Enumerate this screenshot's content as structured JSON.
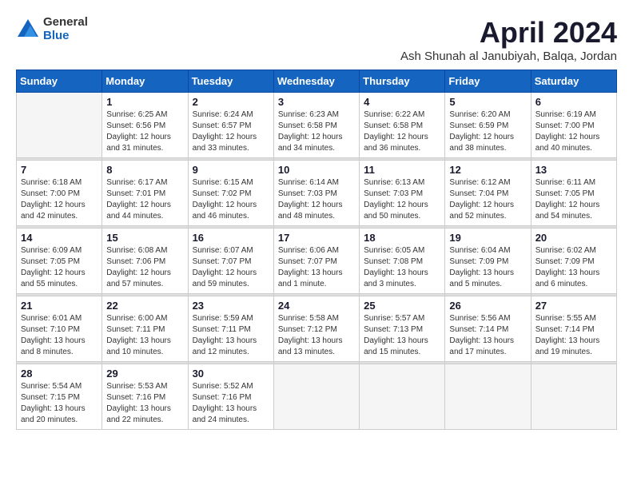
{
  "logo": {
    "general": "General",
    "blue": "Blue"
  },
  "header": {
    "month_year": "April 2024",
    "location": "Ash Shunah al Janubiyah, Balqa, Jordan"
  },
  "weekdays": [
    "Sunday",
    "Monday",
    "Tuesday",
    "Wednesday",
    "Thursday",
    "Friday",
    "Saturday"
  ],
  "weeks": [
    [
      {
        "day": "",
        "info": ""
      },
      {
        "day": "1",
        "info": "Sunrise: 6:25 AM\nSunset: 6:56 PM\nDaylight: 12 hours\nand 31 minutes."
      },
      {
        "day": "2",
        "info": "Sunrise: 6:24 AM\nSunset: 6:57 PM\nDaylight: 12 hours\nand 33 minutes."
      },
      {
        "day": "3",
        "info": "Sunrise: 6:23 AM\nSunset: 6:58 PM\nDaylight: 12 hours\nand 34 minutes."
      },
      {
        "day": "4",
        "info": "Sunrise: 6:22 AM\nSunset: 6:58 PM\nDaylight: 12 hours\nand 36 minutes."
      },
      {
        "day": "5",
        "info": "Sunrise: 6:20 AM\nSunset: 6:59 PM\nDaylight: 12 hours\nand 38 minutes."
      },
      {
        "day": "6",
        "info": "Sunrise: 6:19 AM\nSunset: 7:00 PM\nDaylight: 12 hours\nand 40 minutes."
      }
    ],
    [
      {
        "day": "7",
        "info": "Sunrise: 6:18 AM\nSunset: 7:00 PM\nDaylight: 12 hours\nand 42 minutes."
      },
      {
        "day": "8",
        "info": "Sunrise: 6:17 AM\nSunset: 7:01 PM\nDaylight: 12 hours\nand 44 minutes."
      },
      {
        "day": "9",
        "info": "Sunrise: 6:15 AM\nSunset: 7:02 PM\nDaylight: 12 hours\nand 46 minutes."
      },
      {
        "day": "10",
        "info": "Sunrise: 6:14 AM\nSunset: 7:03 PM\nDaylight: 12 hours\nand 48 minutes."
      },
      {
        "day": "11",
        "info": "Sunrise: 6:13 AM\nSunset: 7:03 PM\nDaylight: 12 hours\nand 50 minutes."
      },
      {
        "day": "12",
        "info": "Sunrise: 6:12 AM\nSunset: 7:04 PM\nDaylight: 12 hours\nand 52 minutes."
      },
      {
        "day": "13",
        "info": "Sunrise: 6:11 AM\nSunset: 7:05 PM\nDaylight: 12 hours\nand 54 minutes."
      }
    ],
    [
      {
        "day": "14",
        "info": "Sunrise: 6:09 AM\nSunset: 7:05 PM\nDaylight: 12 hours\nand 55 minutes."
      },
      {
        "day": "15",
        "info": "Sunrise: 6:08 AM\nSunset: 7:06 PM\nDaylight: 12 hours\nand 57 minutes."
      },
      {
        "day": "16",
        "info": "Sunrise: 6:07 AM\nSunset: 7:07 PM\nDaylight: 12 hours\nand 59 minutes."
      },
      {
        "day": "17",
        "info": "Sunrise: 6:06 AM\nSunset: 7:07 PM\nDaylight: 13 hours\nand 1 minute."
      },
      {
        "day": "18",
        "info": "Sunrise: 6:05 AM\nSunset: 7:08 PM\nDaylight: 13 hours\nand 3 minutes."
      },
      {
        "day": "19",
        "info": "Sunrise: 6:04 AM\nSunset: 7:09 PM\nDaylight: 13 hours\nand 5 minutes."
      },
      {
        "day": "20",
        "info": "Sunrise: 6:02 AM\nSunset: 7:09 PM\nDaylight: 13 hours\nand 6 minutes."
      }
    ],
    [
      {
        "day": "21",
        "info": "Sunrise: 6:01 AM\nSunset: 7:10 PM\nDaylight: 13 hours\nand 8 minutes."
      },
      {
        "day": "22",
        "info": "Sunrise: 6:00 AM\nSunset: 7:11 PM\nDaylight: 13 hours\nand 10 minutes."
      },
      {
        "day": "23",
        "info": "Sunrise: 5:59 AM\nSunset: 7:11 PM\nDaylight: 13 hours\nand 12 minutes."
      },
      {
        "day": "24",
        "info": "Sunrise: 5:58 AM\nSunset: 7:12 PM\nDaylight: 13 hours\nand 13 minutes."
      },
      {
        "day": "25",
        "info": "Sunrise: 5:57 AM\nSunset: 7:13 PM\nDaylight: 13 hours\nand 15 minutes."
      },
      {
        "day": "26",
        "info": "Sunrise: 5:56 AM\nSunset: 7:14 PM\nDaylight: 13 hours\nand 17 minutes."
      },
      {
        "day": "27",
        "info": "Sunrise: 5:55 AM\nSunset: 7:14 PM\nDaylight: 13 hours\nand 19 minutes."
      }
    ],
    [
      {
        "day": "28",
        "info": "Sunrise: 5:54 AM\nSunset: 7:15 PM\nDaylight: 13 hours\nand 20 minutes."
      },
      {
        "day": "29",
        "info": "Sunrise: 5:53 AM\nSunset: 7:16 PM\nDaylight: 13 hours\nand 22 minutes."
      },
      {
        "day": "30",
        "info": "Sunrise: 5:52 AM\nSunset: 7:16 PM\nDaylight: 13 hours\nand 24 minutes."
      },
      {
        "day": "",
        "info": ""
      },
      {
        "day": "",
        "info": ""
      },
      {
        "day": "",
        "info": ""
      },
      {
        "day": "",
        "info": ""
      }
    ]
  ]
}
